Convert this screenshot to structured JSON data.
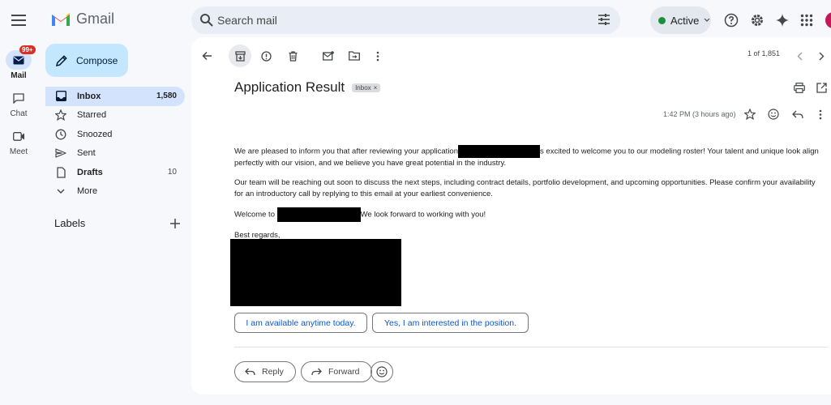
{
  "app": {
    "logo_text": "Gmail",
    "search_placeholder": "Search mail",
    "status_label": "Active",
    "icons": [
      "menu-icon",
      "search-icon",
      "tune-icon",
      "help-icon",
      "settings-icon",
      "gemini-icon",
      "apps-icon"
    ]
  },
  "rail": {
    "items": [
      {
        "label": "Mail",
        "badge": "99+"
      },
      {
        "label": "Chat"
      },
      {
        "label": "Meet"
      }
    ]
  },
  "compose_label": "Compose",
  "nav": [
    {
      "label": "Inbox",
      "count": "1,580"
    },
    {
      "label": "Starred"
    },
    {
      "label": "Snoozed"
    },
    {
      "label": "Sent"
    },
    {
      "label": "Drafts",
      "count": "10"
    },
    {
      "label": "More"
    }
  ],
  "labels_heading": "Labels",
  "toolbar": {
    "pager": "1 of 1,851"
  },
  "email": {
    "subject": "Application Result",
    "chip": "Inbox",
    "time": "1:42 PM (3 hours ago)",
    "p1a": "We are pleased to inform you that after reviewing your application",
    "p1b": "s excited to welcome you to our modeling roster! Your talent and unique look align perfectly with our vision, and we believe you have great potential in the industry.",
    "p2": "Our team will be reaching out soon to discuss the next steps, including contract details, portfolio development, and upcoming opportunities. Please confirm your availability for an introductory call by replying to this email at your earliest convenience.",
    "p3a": "Welcome to",
    "p3b": "We look forward to working with you!",
    "p4": "Best regards,"
  },
  "smart_replies": [
    "I am available anytime today.",
    "Yes, I am interested in the position."
  ],
  "actions": {
    "reply": "Reply",
    "forward": "Forward"
  },
  "colors": {
    "accent": "#0b57d0",
    "compose_bg": "#c2e7ff",
    "selected_bg": "#d3e3fd",
    "badge": "#d93025",
    "active_dot": "#1e8e3e"
  }
}
